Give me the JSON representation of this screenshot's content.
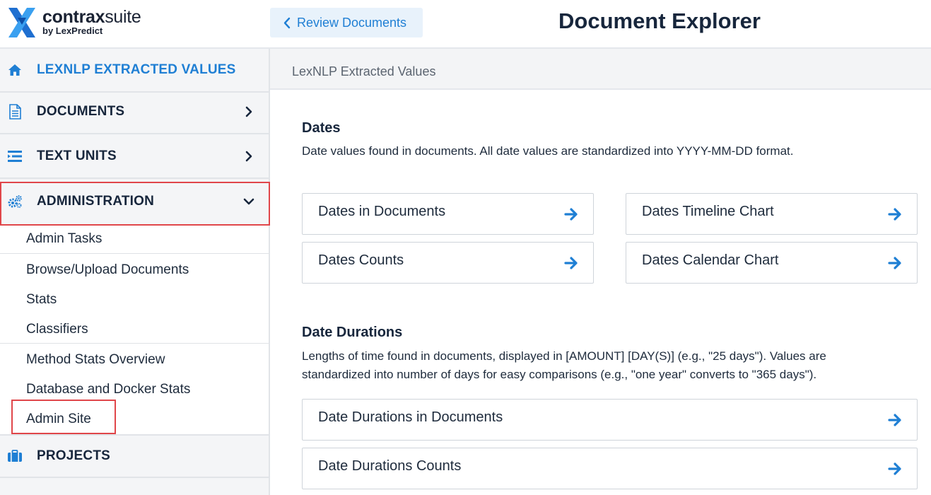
{
  "brand": {
    "name_bold": "contrax",
    "name_light": "suite",
    "subtitle": "by LexPredict",
    "accent": "#1f7fd4",
    "highlight": "#e0464a"
  },
  "header": {
    "back_button": "Review Documents",
    "back_icon": "chevron-left-icon",
    "title": "Document Explorer"
  },
  "sidebar": {
    "items": [
      {
        "label": "LEXNLP EXTRACTED VALUES",
        "icon": "home-icon",
        "active": true
      },
      {
        "label": "DOCUMENTS",
        "icon": "document-icon",
        "chevron": "chevron-right-icon"
      },
      {
        "label": "TEXT UNITS",
        "icon": "list-icon",
        "chevron": "chevron-right-icon"
      },
      {
        "label": "ADMINISTRATION",
        "icon": "gears-icon",
        "chevron": "chevron-down-icon",
        "expanded": true
      },
      {
        "label": "PROJECTS",
        "icon": "briefcase-icon"
      }
    ],
    "admin_submenu": [
      "Admin Tasks",
      "Browse/Upload Documents",
      "Stats",
      "Classifiers",
      "Method Stats Overview",
      "Database and Docker Stats",
      "Admin Site"
    ]
  },
  "main": {
    "breadcrumb": "LexNLP Extracted Values",
    "sections": [
      {
        "title": "Dates",
        "description": "Date values found in documents. All date values are standardized into YYYY-MM-DD format.",
        "cards": [
          "Dates in Documents",
          "Dates Timeline Chart",
          "Dates Counts",
          "Dates Calendar Chart"
        ]
      },
      {
        "title": "Date Durations",
        "description_line1": "Lengths of time found in documents, displayed in [AMOUNT] [DAY(S)] (e.g., \"25 days\"). Values are",
        "description_line2": "standardized into number of days for easy comparisons (e.g., \"one year\" converts to \"365 days\").",
        "cards": [
          "Date Durations in Documents",
          "Date Durations Counts"
        ]
      }
    ]
  }
}
